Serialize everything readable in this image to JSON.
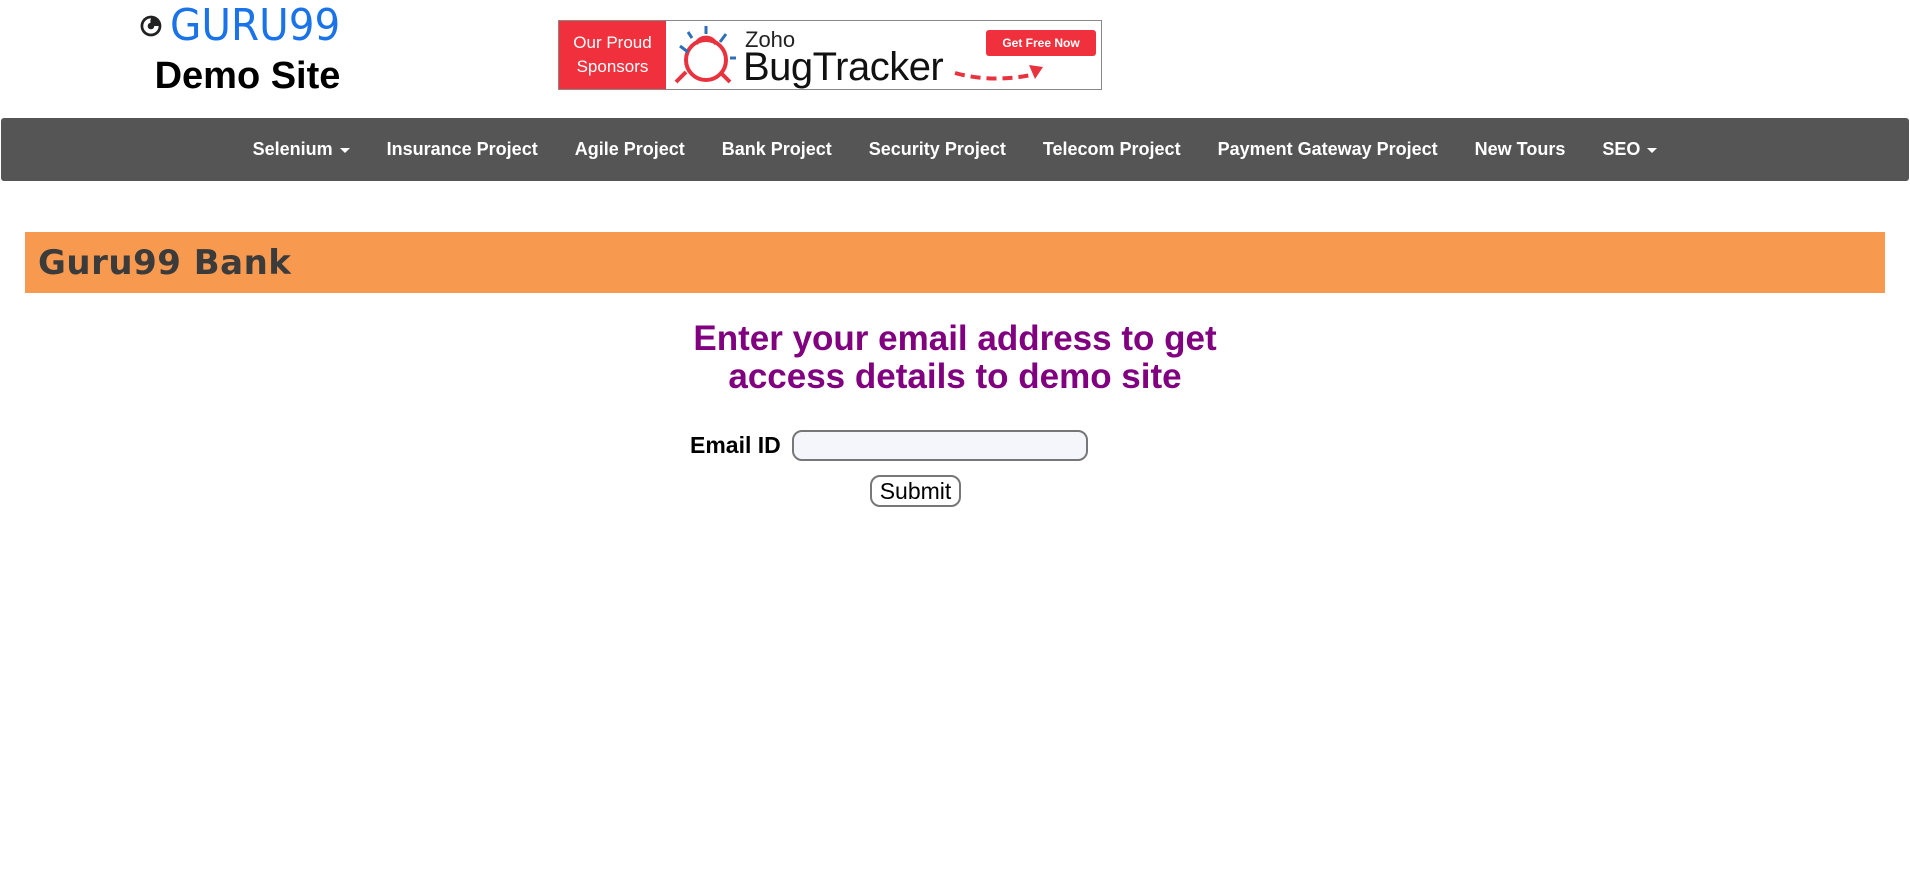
{
  "header": {
    "logo_text": "GURU99",
    "site_subtitle": "Demo Site"
  },
  "sponsor_banner": {
    "left_line1": "Our Proud",
    "left_line2": "Sponsors",
    "brand_small": "Zoho",
    "brand_large": "BugTracker",
    "cta_label": "Get Free Now"
  },
  "navbar": {
    "items": [
      {
        "label": "Selenium",
        "dropdown": true
      },
      {
        "label": "Insurance Project",
        "dropdown": false
      },
      {
        "label": "Agile Project",
        "dropdown": false
      },
      {
        "label": "Bank Project",
        "dropdown": false
      },
      {
        "label": "Security Project",
        "dropdown": false
      },
      {
        "label": "Telecom Project",
        "dropdown": false
      },
      {
        "label": "Payment Gateway Project",
        "dropdown": false
      },
      {
        "label": "New Tours",
        "dropdown": false
      },
      {
        "label": "SEO",
        "dropdown": true
      }
    ]
  },
  "bank_bar": {
    "title": "Guru99 Bank"
  },
  "main": {
    "prompt_line1": "Enter your email address to get",
    "prompt_line2": "access details to demo site",
    "email_label": "Email ID",
    "email_value": "",
    "submit_label": "Submit"
  },
  "colors": {
    "navbar_bg": "#555555",
    "bank_bar_bg": "#f79a50",
    "prompt_text": "#800080",
    "logo_blue": "#1a73e8",
    "sponsor_red": "#f0313d"
  }
}
